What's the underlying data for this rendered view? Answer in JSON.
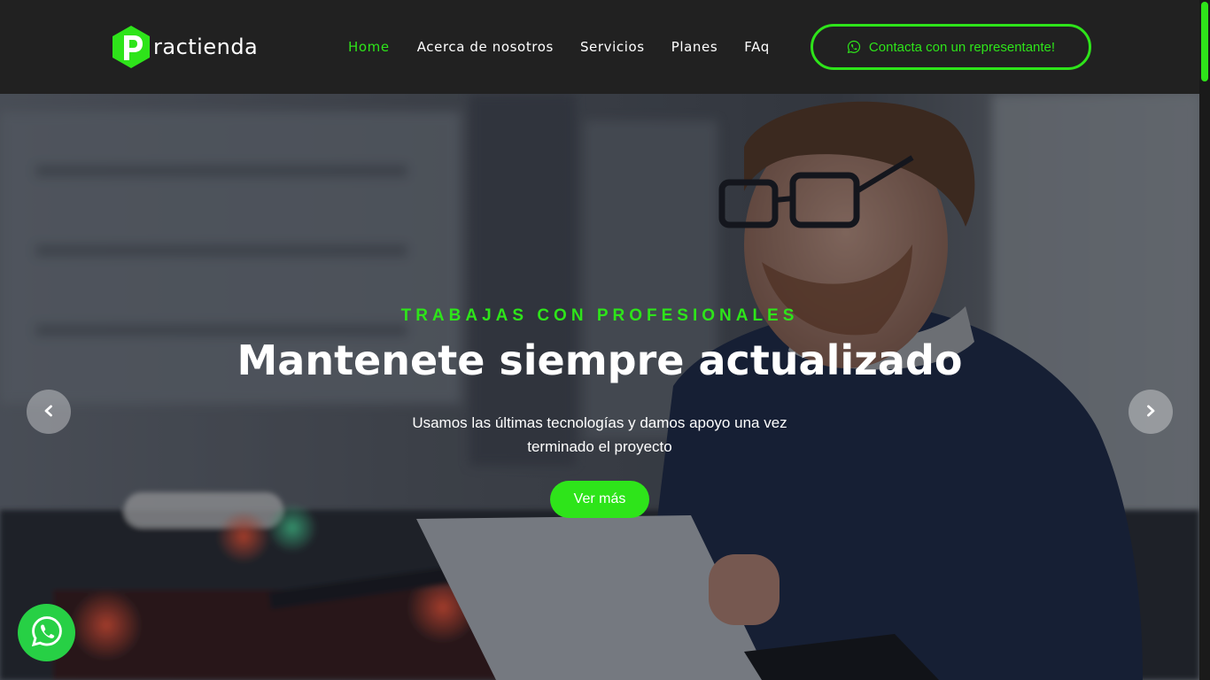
{
  "brand": {
    "logo_letter": "P",
    "logo_text": "ractienda",
    "accent_color": "#2ee41a"
  },
  "nav": {
    "items": [
      {
        "label": "Home",
        "active": true
      },
      {
        "label": "Acerca de nosotros",
        "active": false
      },
      {
        "label": "Servicios",
        "active": false
      },
      {
        "label": "Planes",
        "active": false
      },
      {
        "label": "FAq",
        "active": false
      }
    ]
  },
  "cta": {
    "label": "Contacta con un representante!",
    "icon": "whatsapp-icon"
  },
  "hero": {
    "eyebrow": "TRABAJAS CON PROFESIONALES",
    "title": "Mantenete siempre actualizado",
    "description": "Usamos las últimas tecnologías y damos apoyo una vez terminado el proyecto",
    "button_label": "Ver más",
    "prev_icon": "chevron-left-icon",
    "next_icon": "chevron-right-icon"
  },
  "floating_whatsapp": {
    "icon": "whatsapp-icon",
    "color": "#27d045"
  }
}
